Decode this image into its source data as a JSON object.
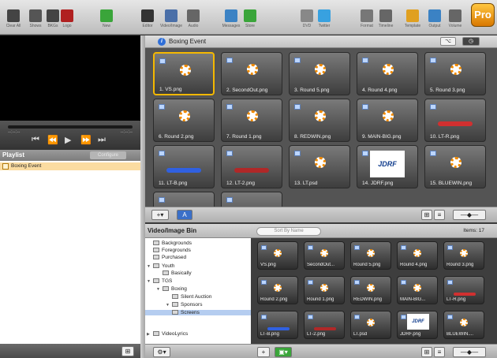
{
  "toolbar": {
    "buttons": [
      {
        "label": "Clear All",
        "icon": "x-icon",
        "color": "#444"
      },
      {
        "label": "Shows",
        "icon": "monitor-icon",
        "color": "#555"
      },
      {
        "label": "BKGs",
        "icon": "screen-icon",
        "color": "#444"
      },
      {
        "label": "Logo",
        "icon": "logo-icon",
        "color": "#b02020"
      },
      {
        "label": "New",
        "icon": "new-icon",
        "color": "#3aa53a"
      },
      {
        "label": "Editor",
        "icon": "editor-icon",
        "color": "#333"
      },
      {
        "label": "Video/Image",
        "icon": "video-icon",
        "color": "#4a6fa8"
      },
      {
        "label": "Audio",
        "icon": "audio-icon",
        "color": "#666"
      },
      {
        "label": "Messages",
        "icon": "messages-icon",
        "color": "#3b82c4"
      },
      {
        "label": "Store",
        "icon": "store-icon",
        "color": "#3aa53a"
      },
      {
        "label": "DVD",
        "icon": "dvd-icon",
        "color": "#888"
      },
      {
        "label": "Twitter",
        "icon": "twitter-icon",
        "color": "#38a1e0"
      },
      {
        "label": "Format",
        "icon": "format-icon",
        "color": "#777"
      },
      {
        "label": "Timeline",
        "icon": "timeline-icon",
        "color": "#666"
      },
      {
        "label": "Template",
        "icon": "template-icon",
        "color": "#e0a020"
      },
      {
        "label": "Output",
        "icon": "output-icon",
        "color": "#3b82c4"
      },
      {
        "label": "Volume",
        "icon": "volume-icon",
        "color": "#666"
      }
    ],
    "pro_badge": "Pro"
  },
  "preview": {
    "timecode_left": "--:--:--",
    "timecode_right": "--:--:--"
  },
  "playlist": {
    "title": "Playlist",
    "configure_label": "Configure",
    "items": [
      {
        "label": "Boxing Event"
      }
    ]
  },
  "slides_panel": {
    "title": "Boxing Event",
    "slides": [
      {
        "label": "1.  VS.png",
        "type": "sun"
      },
      {
        "label": "2. SecondOut.png",
        "type": "sun"
      },
      {
        "label": "3. Round 5.png",
        "type": "sun"
      },
      {
        "label": "4. Round 4.png",
        "type": "sun"
      },
      {
        "label": "5. Round 3.png",
        "type": "sun"
      },
      {
        "label": "6. Round 2.png",
        "type": "sun"
      },
      {
        "label": "7. Round 1.png",
        "type": "sun"
      },
      {
        "label": "8. REDWIN.png",
        "type": "sun"
      },
      {
        "label": "9. MAIN-BIG.png",
        "type": "sun"
      },
      {
        "label": "10. LT-R.png",
        "type": "bar",
        "bar_color": "#d03030"
      },
      {
        "label": "11. LT-B.png",
        "type": "bar",
        "bar_color": "#3060e0"
      },
      {
        "label": "12. LT-2.png",
        "type": "bar",
        "bar_color": "#b02828"
      },
      {
        "label": "13. LT.psd",
        "type": "sun"
      },
      {
        "label": "14. JDRF.png",
        "type": "jdrf",
        "logo_text": "JDRF"
      },
      {
        "label": "15. BLUEWIN.png",
        "type": "sun"
      },
      {
        "label": "",
        "type": "blank"
      },
      {
        "label": "",
        "type": "blank"
      }
    ]
  },
  "media_bin": {
    "title": "Video/Image Bin",
    "sort_placeholder": "Sort By Name",
    "items_count": "Items: 17",
    "tree": [
      {
        "label": "Backgrounds",
        "depth": 0,
        "expanded": null
      },
      {
        "label": "Foregrounds",
        "depth": 0,
        "expanded": null
      },
      {
        "label": "Purchased",
        "depth": 0,
        "expanded": null
      },
      {
        "label": "Youth",
        "depth": 0,
        "expanded": true
      },
      {
        "label": "Basically",
        "depth": 1,
        "expanded": null
      },
      {
        "label": "TGS",
        "depth": 0,
        "expanded": true
      },
      {
        "label": "Boxing",
        "depth": 1,
        "expanded": true
      },
      {
        "label": "Silent Auction",
        "depth": 2,
        "expanded": null
      },
      {
        "label": "Sponsors",
        "depth": 2,
        "expanded": true
      },
      {
        "label": "Screens",
        "depth": 2,
        "expanded": null,
        "selected": true
      },
      {
        "label": "VideoLyrics",
        "depth": 0,
        "expanded": false
      }
    ],
    "thumbs": [
      {
        "label": "VS.png",
        "type": "sun"
      },
      {
        "label": "SecondOut...",
        "type": "sun"
      },
      {
        "label": "Round 5.png",
        "type": "sun"
      },
      {
        "label": "Round 4.png",
        "type": "sun"
      },
      {
        "label": "Round 3.png",
        "type": "sun"
      },
      {
        "label": "Round 2.png",
        "type": "sun"
      },
      {
        "label": "Round 1.png",
        "type": "sun"
      },
      {
        "label": "REDWIN.png",
        "type": "sun"
      },
      {
        "label": "MAIN-BIG...",
        "type": "sun"
      },
      {
        "label": "LT-R.png",
        "type": "bar",
        "bar_color": "#d03030"
      },
      {
        "label": "LT-B.png",
        "type": "bar",
        "bar_color": "#3060e0"
      },
      {
        "label": "LT-2.png",
        "type": "bar",
        "bar_color": "#b02828"
      },
      {
        "label": "LT.psd",
        "type": "sun"
      },
      {
        "label": "JDRF.png",
        "type": "jdrf",
        "logo_text": "JDRF"
      },
      {
        "label": "BLUEWIN....",
        "type": "sun"
      }
    ]
  },
  "colors": {
    "selection": "#f5b800",
    "playlist_item": "#fbdca1"
  }
}
